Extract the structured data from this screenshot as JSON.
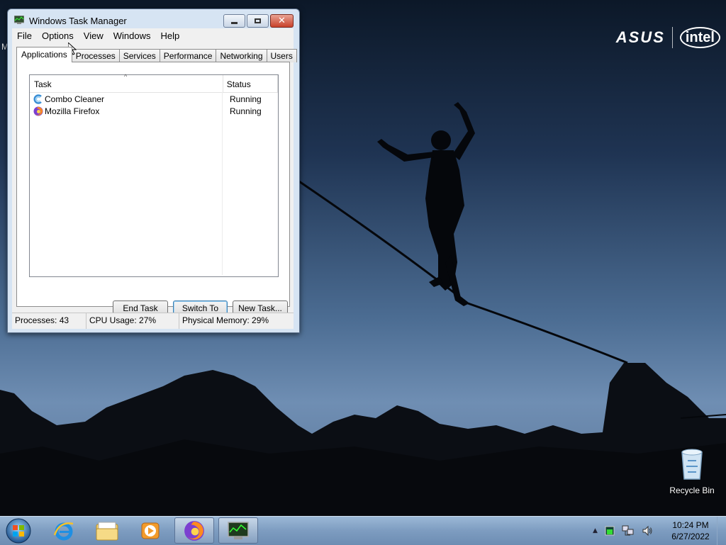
{
  "window": {
    "title": "Windows Task Manager",
    "close_glyph": "✕"
  },
  "menu": [
    "File",
    "Options",
    "View",
    "Windows",
    "Help"
  ],
  "tabs": [
    "Applications",
    "Processes",
    "Services",
    "Performance",
    "Networking",
    "Users"
  ],
  "list": {
    "columns": {
      "task": "Task",
      "status": "Status"
    },
    "sort_glyph": "^",
    "rows": [
      {
        "task": "Combo Cleaner",
        "status": "Running",
        "icon": "combo-cleaner-icon"
      },
      {
        "task": "Mozilla Firefox",
        "status": "Running",
        "icon": "firefox-icon"
      }
    ]
  },
  "buttons": {
    "end_task": "End Task",
    "switch_to": "Switch To",
    "new_task": "New Task..."
  },
  "status": {
    "processes": "Processes: 43",
    "cpu": "CPU Usage: 27%",
    "memory": "Physical Memory: 29%"
  },
  "desktop": {
    "brand_asus": "ASUS",
    "brand_intel": "intel",
    "edge_letter": "M",
    "recycle_bin": "Recycle Bin"
  },
  "taskbar": {
    "apps": [
      "internet-explorer-icon",
      "file-explorer-icon",
      "media-player-icon",
      "firefox-icon",
      "task-manager-icon"
    ],
    "tray_arrow": "▲",
    "time": "10:24 PM",
    "date": "6/27/2022"
  },
  "colors": {
    "window_frame": "#d6e4f3",
    "close_button": "#c8412b",
    "taskbar": "#7d9cc0"
  }
}
